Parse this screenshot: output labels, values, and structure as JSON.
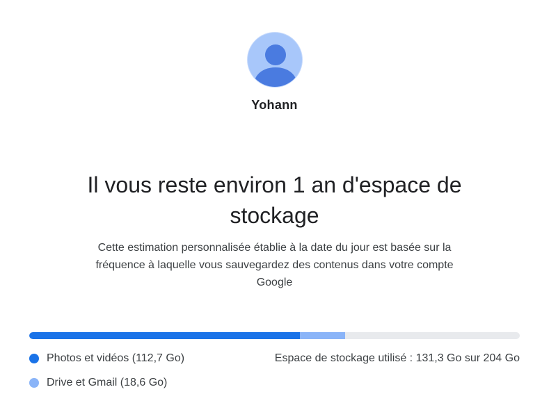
{
  "profile": {
    "name": "Yohann",
    "email": "",
    "avatar_icon": "person-icon",
    "avatar_bg": "#a8c7fa",
    "avatar_fg": "#4a7be0"
  },
  "headline": "Il vous reste environ 1 an d'espace de stockage",
  "subtext": "Cette estimation personnalisée établie à la date du jour est basée sur la fréquence à laquelle vous sauvegardez des contenus dans votre compte Google",
  "storage": {
    "total_gb": 204,
    "used_gb": 131.3,
    "usage_text": "Espace de stockage utilisé : 131,3 Go sur 204 Go",
    "categories": [
      {
        "label": "Photos et vidéos (112,7 Go)",
        "value_gb": 112.7,
        "color": "#1a73e8"
      },
      {
        "label": "Drive et Gmail (18,6 Go)",
        "value_gb": 18.6,
        "color": "#8ab4f8"
      }
    ],
    "track_color": "#e8eaed"
  }
}
